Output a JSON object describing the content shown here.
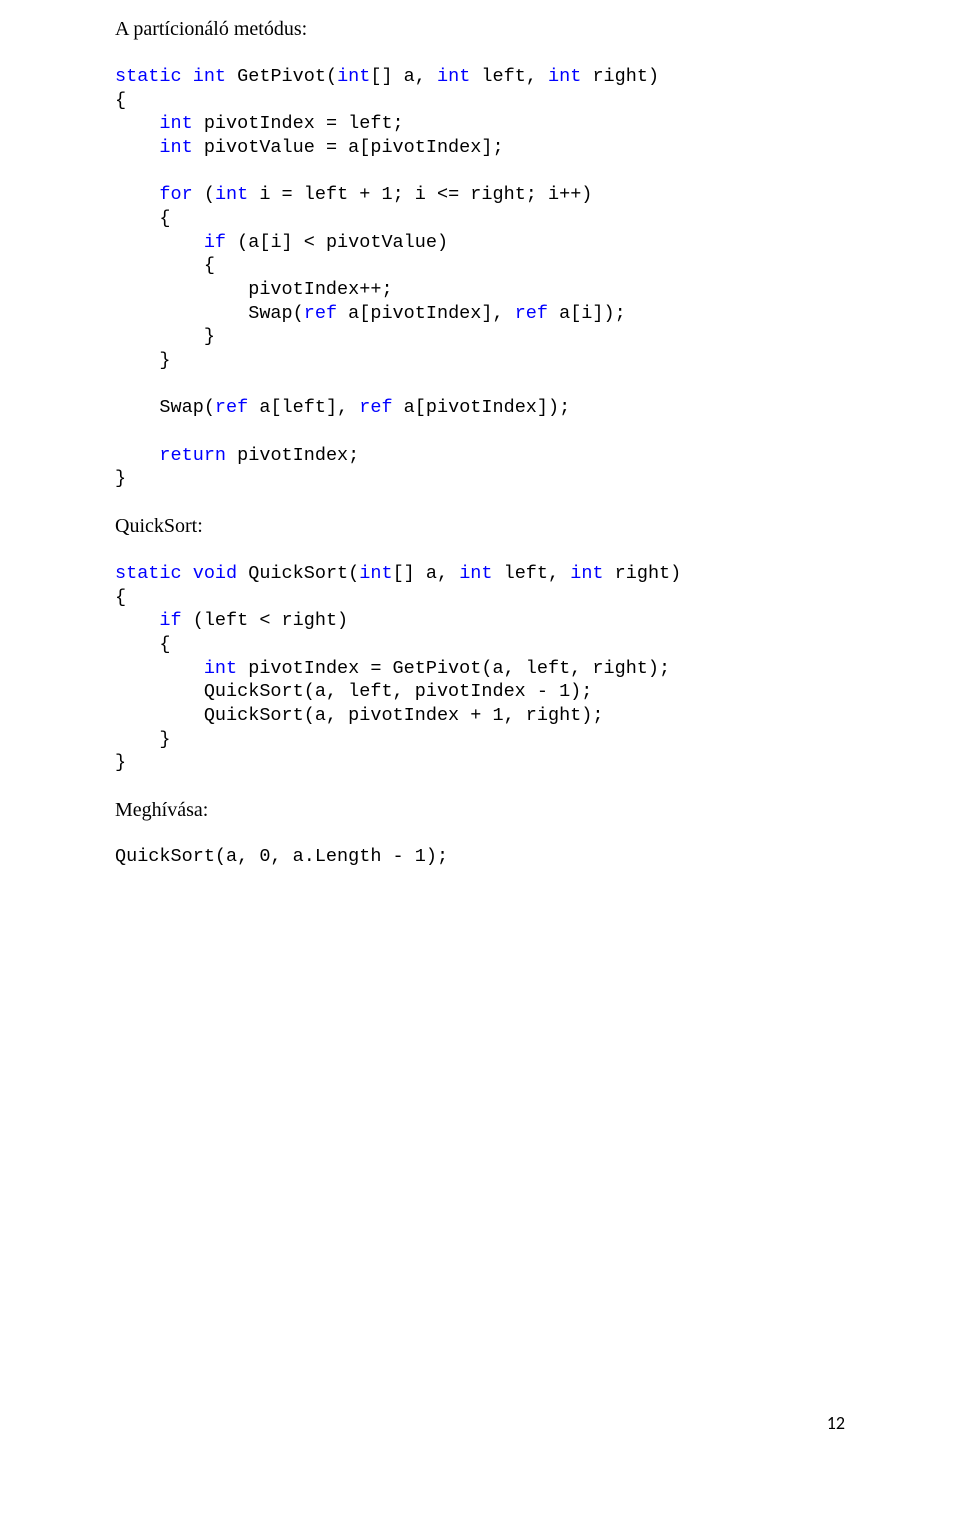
{
  "headings": {
    "partition": "A partícionáló metódus:",
    "quicksort": "QuickSort:",
    "call": "Meghívása:"
  },
  "code": {
    "sig1_pre": "static int",
    "sig1_post": " GetPivot(",
    "sig1_params": "int",
    "sig1_params_a": "[] a, ",
    "sig1_params_b": " left, ",
    "sig1_params_c": " right)",
    "l_open": "{",
    "l_close": "}",
    "pivotIndex_decl_kw": "    int",
    "pivotIndex_decl_rest": " pivotIndex = left;",
    "pivotValue_decl_kw": "    int",
    "pivotValue_decl_rest": " pivotValue = a[pivotIndex];",
    "for_kw": "    for",
    "for_open": " (",
    "for_int": "int",
    "for_rest": " i = left + 1; i <= right; i++)",
    "for_brace_open": "    {",
    "if_kw": "        if",
    "if_cond": " (a[i] < pivotValue)",
    "if_brace_open": "        {",
    "pivotpp": "            pivotIndex++;",
    "swap_kw": "            Swap(",
    "swap_ref1": "ref",
    "swap_mid1": " a[pivotIndex], ",
    "swap_ref2": "ref",
    "swap_end1": " a[i]);",
    "if_brace_close": "        }",
    "for_brace_close": "    }",
    "swap2_pre": "    Swap(",
    "swap2_ref1": "ref",
    "swap2_mid": " a[left], ",
    "swap2_ref2": "ref",
    "swap2_end": " a[pivotIndex]);",
    "return_kw": "    return",
    "return_rest": " pivotIndex;",
    "qs_sig_pre": "static void",
    "qs_sig_name": " QuickSort(",
    "qs_sig_a": "[] a, ",
    "qs_sig_b": " left, ",
    "qs_sig_c": " right)",
    "qs_if_kw": "    if",
    "qs_if_cond": " (left < right)",
    "qs_brace_open": "    {",
    "qs_pivot_kw": "        int",
    "qs_pivot_rest": " pivotIndex = GetPivot(a, left, right);",
    "qs_call1": "        QuickSort(a, left, pivotIndex - 1);",
    "qs_call2": "        QuickSort(a, pivotIndex + 1, right);",
    "qs_brace_close": "    }",
    "call_line": "QuickSort(a, 0, a.Length - 1);"
  },
  "page_number": "12"
}
